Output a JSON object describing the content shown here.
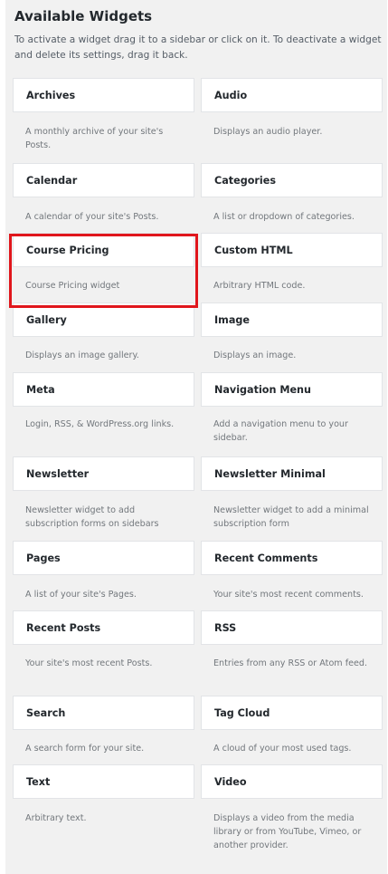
{
  "header": {
    "title": "Available Widgets",
    "description": "To activate a widget drag it to a sidebar or click on it. To deactivate a widget and delete its settings, drag it back."
  },
  "widgets": [
    {
      "name": "Archives",
      "description": "A monthly archive of your site's Posts."
    },
    {
      "name": "Audio",
      "description": "Displays an audio player."
    },
    {
      "name": "Calendar",
      "description": "A calendar of your site's Posts."
    },
    {
      "name": "Categories",
      "description": "A list or dropdown of categories."
    },
    {
      "name": "Course Pricing",
      "description": "Course Pricing widget"
    },
    {
      "name": "Custom HTML",
      "description": "Arbitrary HTML code."
    },
    {
      "name": "Gallery",
      "description": "Displays an image gallery."
    },
    {
      "name": "Image",
      "description": "Displays an image."
    },
    {
      "name": "Meta",
      "description": "Login, RSS, & WordPress.org links."
    },
    {
      "name": "Navigation Menu",
      "description": "Add a navigation menu to your sidebar."
    },
    {
      "name": "Newsletter",
      "description": "Newsletter widget to add subscription forms on sidebars"
    },
    {
      "name": "Newsletter Minimal",
      "description": "Newsletter widget to add a minimal subscription form"
    },
    {
      "name": "Pages",
      "description": "A list of your site's Pages."
    },
    {
      "name": "Recent Comments",
      "description": "Your site's most recent comments."
    },
    {
      "name": "Recent Posts",
      "description": "Your site's most recent Posts."
    },
    {
      "name": "RSS",
      "description": "Entries from any RSS or Atom feed."
    },
    {
      "name": "Search",
      "description": "A search form for your site."
    },
    {
      "name": "Tag Cloud",
      "description": "A cloud of your most used tags."
    },
    {
      "name": "Text",
      "description": "Arbitrary text."
    },
    {
      "name": "Video",
      "description": "Displays a video from the media library or from YouTube, Vimeo, or another provider."
    }
  ],
  "colors": {
    "highlight": "#e0161c",
    "panel_background": "#f1f1f1",
    "widget_background": "#ffffff"
  }
}
